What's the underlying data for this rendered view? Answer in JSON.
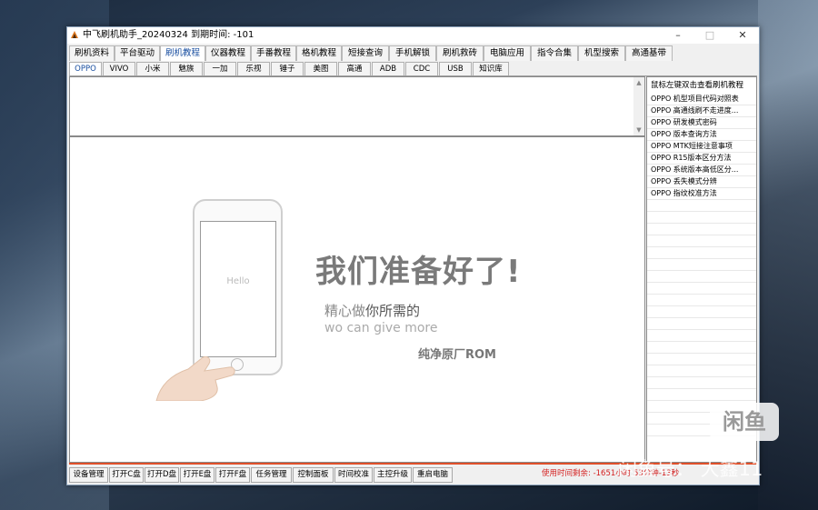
{
  "window": {
    "title": "中飞刷机助手_20240324  到期时间: -101",
    "minimize": "–",
    "maximize": "□",
    "close": "✕"
  },
  "tabs_main": [
    {
      "label": "刷机资料"
    },
    {
      "label": "平台驱动"
    },
    {
      "label": "刷机教程"
    },
    {
      "label": "仪器教程"
    },
    {
      "label": "手番教程"
    },
    {
      "label": "格机教程"
    },
    {
      "label": "短接查询"
    },
    {
      "label": "手机解锁"
    },
    {
      "label": "刷机救砖"
    },
    {
      "label": "电脑应用"
    },
    {
      "label": "指令合集"
    },
    {
      "label": "机型搜索"
    },
    {
      "label": "高通基带"
    }
  ],
  "tabs_main_active": "刷机教程",
  "tabs_brand": [
    {
      "label": "OPPO"
    },
    {
      "label": "VIVO"
    },
    {
      "label": "小米"
    },
    {
      "label": "魅族"
    },
    {
      "label": "一加"
    },
    {
      "label": "乐视"
    },
    {
      "label": "锤子"
    },
    {
      "label": "美图"
    },
    {
      "label": "高通"
    },
    {
      "label": "ADB"
    },
    {
      "label": "CDC"
    },
    {
      "label": "USB"
    },
    {
      "label": "知识库"
    }
  ],
  "tabs_brand_active": "OPPO",
  "right_panel": {
    "header": "鼠标左键双击查看刷机教程",
    "items": [
      "OPPO 机型项目代码对照表",
      "OPPO 高通线刷不走进度...",
      "OPPO 研发模式密码",
      "OPPO 版本查询方法",
      "OPPO MTK短接注意事项",
      "OPPO R15版本区分方法",
      "OPPO 系统版本高低区分...",
      "OPPO 丢失模式分辨",
      "OPPO 指纹校准方法"
    ]
  },
  "promo": {
    "phone_screen_text": "Hello",
    "headline": "我们准备好了!",
    "line1_a": "精心做",
    "line1_b": "你所需的",
    "line2": "wo can give more",
    "line3": "纯净原厂ROM"
  },
  "bottom_buttons": [
    {
      "label": "设备管理"
    },
    {
      "label": "打开C盘"
    },
    {
      "label": "打开D盘"
    },
    {
      "label": "打开E盘"
    },
    {
      "label": "打开F盘"
    },
    {
      "label": "任务管理"
    },
    {
      "label": "控制面板"
    },
    {
      "label": "时间校准"
    },
    {
      "label": "主控升级"
    },
    {
      "label": "重启电脑"
    }
  ],
  "usage_text": "使用时间剩余:  -1651小时 53分钟-13秒",
  "overlay": {
    "badge": "闲鱼",
    "watermark": "闲鱼号：  大鑫11"
  },
  "colors": {
    "active_tab_text": "#1a4fa0",
    "usage_text": "#d41e1e",
    "divider": "#e0502a"
  }
}
